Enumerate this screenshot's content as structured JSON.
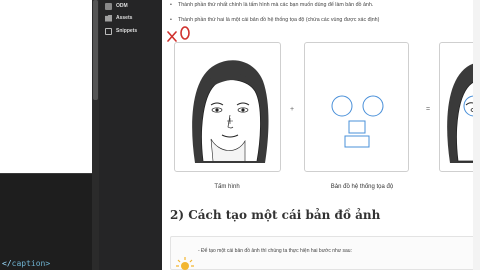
{
  "editor": {
    "caption_tag": "caption>"
  },
  "side_panel": {
    "items": [
      {
        "label": "ODM",
        "icon": "odm-icon"
      },
      {
        "label": "Assets",
        "icon": "folder-icon"
      },
      {
        "label": "Snippets",
        "icon": "snippet-icon"
      }
    ]
  },
  "document": {
    "bullets": [
      "Thành phần thứ nhất chính là tấm hình mà các bạn muốn dùng để làm bản đồ ảnh.",
      "Thành phần thứ hai là một cái bản đồ hệ thống tọa độ (chứa các vùng được xác định)"
    ],
    "annotation": "x o",
    "figure": {
      "plus": "+",
      "equals": "=",
      "captions": [
        "Tấm hình",
        "Bản đồ hệ thống tọa độ"
      ]
    },
    "section_heading": "2) Cách tạo một cái bản đồ ảnh",
    "note": "- Để tạo một cái bản đồ ảnh thì chúng ta thực hiện hai bước như sau:"
  }
}
